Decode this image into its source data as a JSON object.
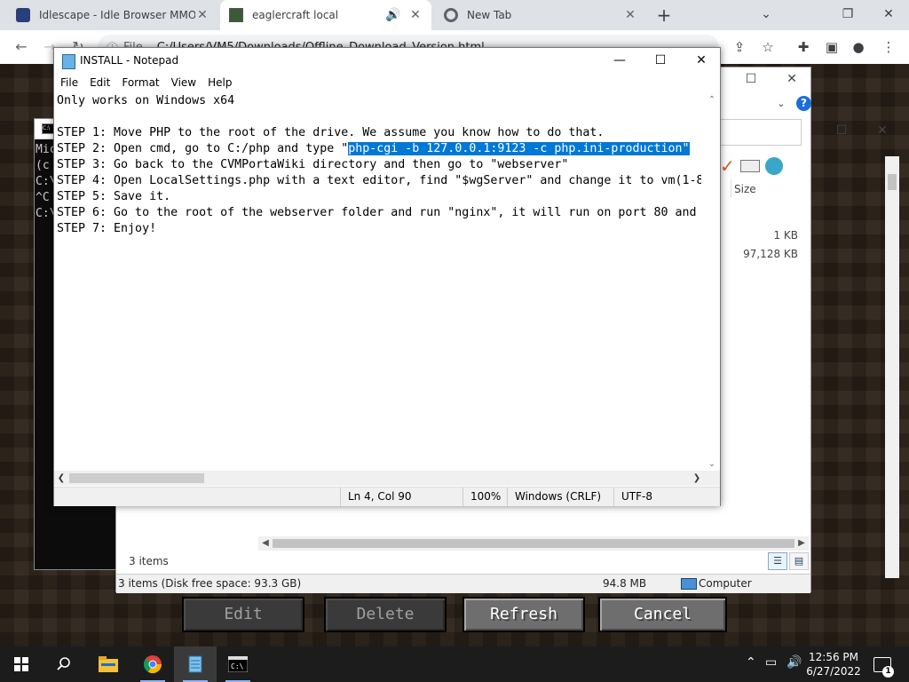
{
  "browser": {
    "tabs": [
      {
        "label": "Idlescape - Idle Browser MMORPG",
        "active": false
      },
      {
        "label": "eaglercraft local",
        "active": true
      },
      {
        "label": "New Tab",
        "active": false
      }
    ],
    "new_tab_glyph": "+",
    "window_controls": {
      "minimize": "⌄",
      "restore": "❐",
      "close": "✕"
    },
    "address": {
      "scheme_label": "File",
      "url": "C:/Users/VM5/Downloads/Offline_Download_Version.html"
    }
  },
  "console": {
    "lines": [
      "Mic",
      "(c",
      "",
      "C:\\",
      "^C",
      "C:\\"
    ]
  },
  "explorer": {
    "column_size": "Size",
    "file_sizes": [
      "1 KB",
      "97,128 KB"
    ],
    "item_count": "3 items",
    "status": {
      "left": "3 items (Disk free space: 93.3 GB)",
      "size": "94.8 MB",
      "location": "Computer"
    }
  },
  "notepad": {
    "title": "INSTALL - Notepad",
    "menu": [
      "File",
      "Edit",
      "Format",
      "View",
      "Help"
    ],
    "lines": [
      {
        "text": "Only works on Windows x64"
      },
      {
        "text": ""
      },
      {
        "text": "STEP 1: Move PHP to the root of the drive. We assume you know how to do that."
      },
      {
        "text": "STEP 2: Open cmd, go to C:/php and type \"",
        "selected": "php-cgi -b 127.0.0.1:9123 -c php.ini-production\""
      },
      {
        "text": "STEP 3: Go back to the CVMPortaWiki directory and then go to \"webserver\""
      },
      {
        "text": "STEP 4: Open LocalSettings.php with a text editor, find \"$wgServer\" and change it to vm(1-8"
      },
      {
        "text": "STEP 5: Save it."
      },
      {
        "text": "STEP 6: Go to the root of the webserver folder and run \"nginx\", it will run on port 80 and"
      },
      {
        "text": "STEP 7: Enjoy!"
      }
    ],
    "status": {
      "position": "Ln 4, Col 90",
      "zoom": "100%",
      "line_ending": "Windows (CRLF)",
      "encoding": "UTF-8"
    }
  },
  "game_buttons": [
    {
      "label": "Edit",
      "enabled": false
    },
    {
      "label": "Delete",
      "enabled": false
    },
    {
      "label": "Refresh",
      "enabled": true
    },
    {
      "label": "Cancel",
      "enabled": true
    }
  ],
  "taskbar": {
    "time": "12:56 PM",
    "date": "6/27/2022",
    "notification_count": "1"
  }
}
